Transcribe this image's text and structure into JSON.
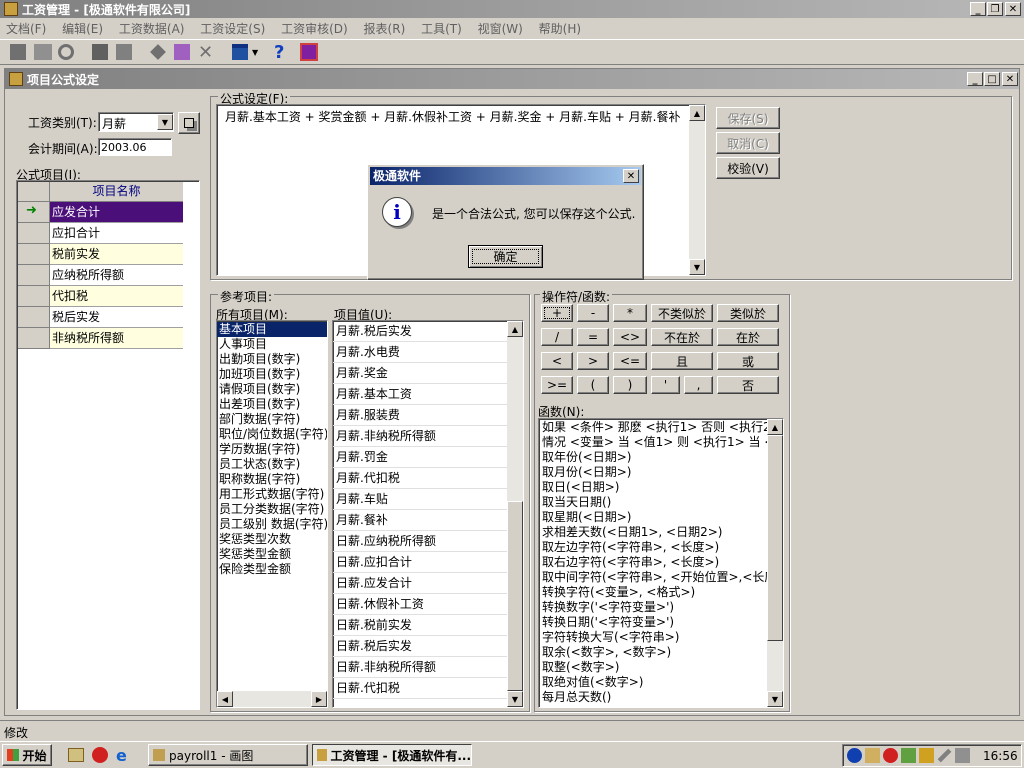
{
  "app": {
    "title": "工资管理 - [极通软件有限公司]"
  },
  "menu": [
    "文档(F)",
    "编辑(E)",
    "工资数据(A)",
    "工资设定(S)",
    "工资审核(D)",
    "报表(R)",
    "工具(T)",
    "视窗(W)",
    "帮助(H)"
  ],
  "child": {
    "title": "项目公式设定"
  },
  "form": {
    "category_label": "工资类别(T):",
    "category_value": "月薪",
    "period_label": "会计期间(A):",
    "period_value": "2003.06",
    "formula_items_label": "公式项目(I):",
    "grid_header": "项目名称",
    "grid_rows": [
      "应发合计",
      "应扣合计",
      "税前实发",
      "应纳税所得额",
      "代扣税",
      "税后实发",
      "非纳税所得额"
    ]
  },
  "formula": {
    "label": "公式设定(F):",
    "text": "月薪.基本工资 + 奖赏金额 + 月薪.休假补工资 + 月薪.奖金 + 月薪.车贴 + 月薪.餐补",
    "save": "保存(S)",
    "cancel": "取消(C)",
    "check": "校验(V)"
  },
  "dialog": {
    "title": "极通软件",
    "message": "是一个合法公式, 您可以保存这个公式.",
    "ok": "确定"
  },
  "reference": {
    "label": "参考项目:",
    "all_items_label": "所有项目(M):",
    "all_items": [
      "基本项目",
      "人事项目",
      "出勤项目(数字)",
      "加班项目(数字)",
      "请假项目(数字)",
      "出差项目(数字)",
      "部门数据(字符)",
      "职位/岗位数据(字符)",
      "学历数据(字符)",
      "员工状态(数字)",
      "职称数据(字符)",
      "用工形式数据(字符)",
      "员工分类数据(字符)",
      "员工级别 数据(字符)",
      "奖惩类型次数",
      "奖惩类型金额",
      "保险类型金额"
    ],
    "values_label": "项目值(U):",
    "values": [
      "月薪.税后实发",
      "月薪.水电费",
      "月薪.奖金",
      "月薪.基本工资",
      "月薪.服装费",
      "月薪.非纳税所得额",
      "月薪.罚金",
      "月薪.代扣税",
      "月薪.车贴",
      "月薪.餐补",
      "日薪.应纳税所得额",
      "日薪.应扣合计",
      "日薪.应发合计",
      "日薪.休假补工资",
      "日薪.税前实发",
      "日薪.税后实发",
      "日薪.非纳税所得额",
      "日薪.代扣税"
    ]
  },
  "operators": {
    "label": "操作符/函数:",
    "rows": [
      [
        "+",
        "-",
        "*",
        "不类似於",
        "类似於"
      ],
      [
        "/",
        "=",
        "<>",
        "不在於",
        "在於"
      ],
      [
        "<",
        ">",
        "<=",
        "且",
        "或"
      ],
      [
        ">=",
        "(",
        ")",
        "'",
        ",",
        "否"
      ]
    ]
  },
  "functions": {
    "label": "函数(N):",
    "items": [
      "如果 <条件> 那麽 <执行1> 否则 <执行2> 如",
      "情况 <变量> 当 <值1> 则 <执行1> 当 <值2>",
      "取年份(<日期>)",
      "取月份(<日期>)",
      "取日(<日期>)",
      "取当天日期()",
      "取星期(<日期>)",
      "求相差天数(<日期1>, <日期2>)",
      "取左边字符(<字符串>, <长度>)",
      "取右边字符(<字符串>, <长度>)",
      "取中间字符(<字符串>, <开始位置>,<长度>)",
      "转换字符(<变量>, <格式>)",
      "转换数字('<字符变量>')",
      "转换日期('<字符变量>')",
      "字符转换大写(<字符串>)",
      "取余(<数字>, <数字>)",
      "取整(<数字>)",
      "取绝对值(<数字>)",
      "每月总天数()"
    ]
  },
  "status": {
    "text": "修改"
  },
  "taskbar": {
    "start": "开始",
    "task1": "payroll1 - 画图",
    "task2": "工资管理 - [极通软件有...",
    "clock": "16:56"
  },
  "colors": {
    "grid_selected": "#4b0f7a",
    "grid_row_alt": "#ffffe0",
    "list_selected": "#0a246a",
    "title_inactive": "#808080",
    "dialog_title": "#0a246a"
  }
}
